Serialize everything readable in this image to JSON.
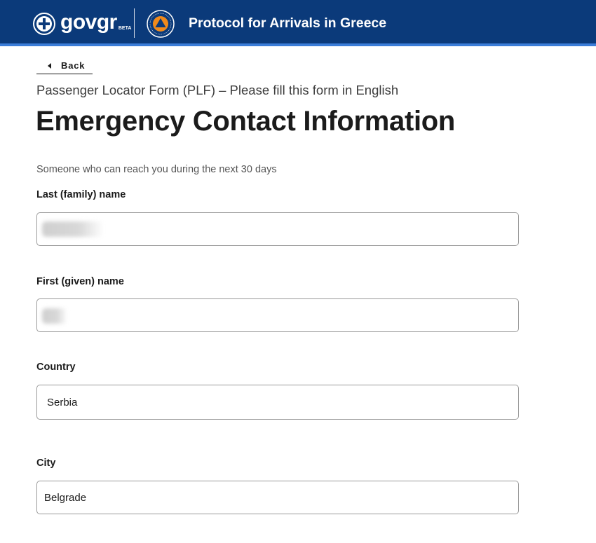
{
  "header": {
    "logo_text_gov": "gov",
    "logo_text_gr": "gr",
    "logo_beta": "BETA",
    "title": "Protocol for Arrivals in Greece",
    "colors": {
      "background": "#0b3a7a",
      "accent": "#3b7dd8",
      "seal_orange": "#f08a1c"
    }
  },
  "nav": {
    "back_label": "Back"
  },
  "page": {
    "caption": "Passenger Locator Form (PLF) – Please fill this form in English",
    "title": "Emergency Contact Information",
    "hint": "Someone who can reach you during the next 30 days"
  },
  "form": {
    "last_name": {
      "label": "Last (family) name",
      "value": ""
    },
    "first_name": {
      "label": "First (given) name",
      "value": ""
    },
    "country": {
      "label": "Country",
      "value": "Serbia"
    },
    "city": {
      "label": "City",
      "value": "Belgrade"
    }
  }
}
